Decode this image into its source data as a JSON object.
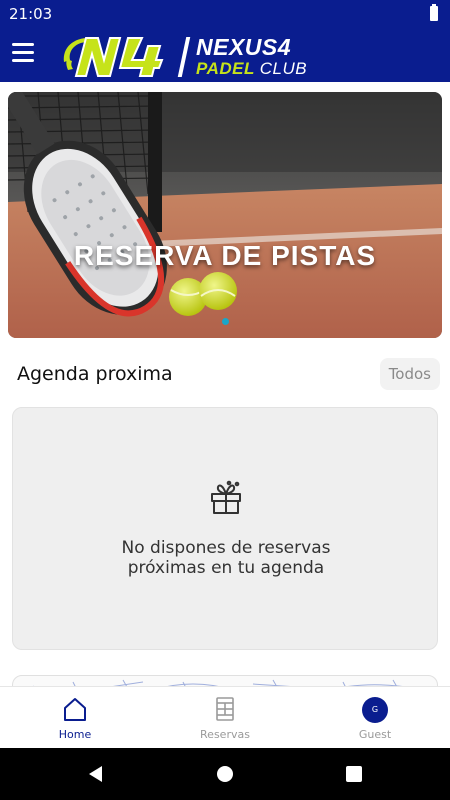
{
  "status_bar": {
    "time": "21:03"
  },
  "app_bar": {
    "logo": {
      "mark": "N4",
      "brand_top": "NEXUS4",
      "brand_bottom_1": "PADEL",
      "brand_bottom_2": "CLUB"
    }
  },
  "banner": {
    "title": "RESERVA DE PISTAS"
  },
  "agenda": {
    "title": "Agenda proxima",
    "all_label": "Todos",
    "empty_line_1": "No dispones de reservas",
    "empty_line_2": "próximas en tu agenda"
  },
  "bottom_nav": {
    "items": [
      {
        "label": "Home",
        "icon": "home-icon",
        "active": true
      },
      {
        "label": "Reservas",
        "icon": "court-icon",
        "active": false
      },
      {
        "label": "Guest",
        "icon": "avatar",
        "avatar_initial": "G",
        "active": false
      }
    ]
  },
  "colors": {
    "primary": "#0a1d8f",
    "accent": "#c6e31a",
    "card_bg": "#efefef"
  }
}
